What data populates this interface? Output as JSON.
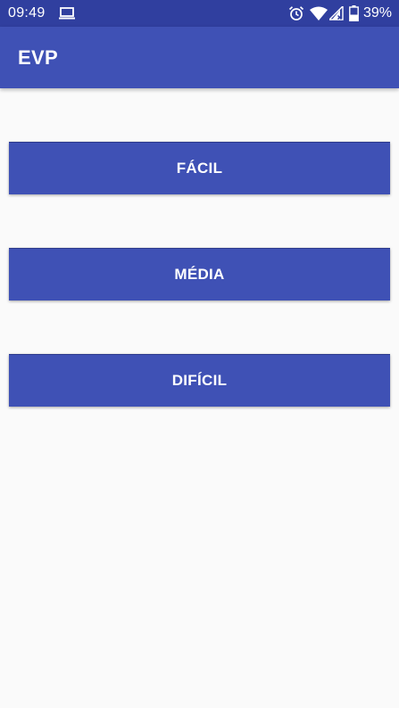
{
  "status_bar": {
    "time": "09:49",
    "battery_percent": "39%",
    "icons": [
      "laptop-icon",
      "alarm-icon",
      "wifi-icon",
      "signal-icon",
      "battery-icon"
    ]
  },
  "app_bar": {
    "title": "EVP"
  },
  "buttons": {
    "easy": "FÁCIL",
    "medium": "MÉDIA",
    "hard": "DIFÍCIL"
  },
  "colors": {
    "status_bar": "#303f9f",
    "primary": "#3f51b5",
    "background": "#fafafa",
    "text_on_primary": "#ffffff"
  }
}
